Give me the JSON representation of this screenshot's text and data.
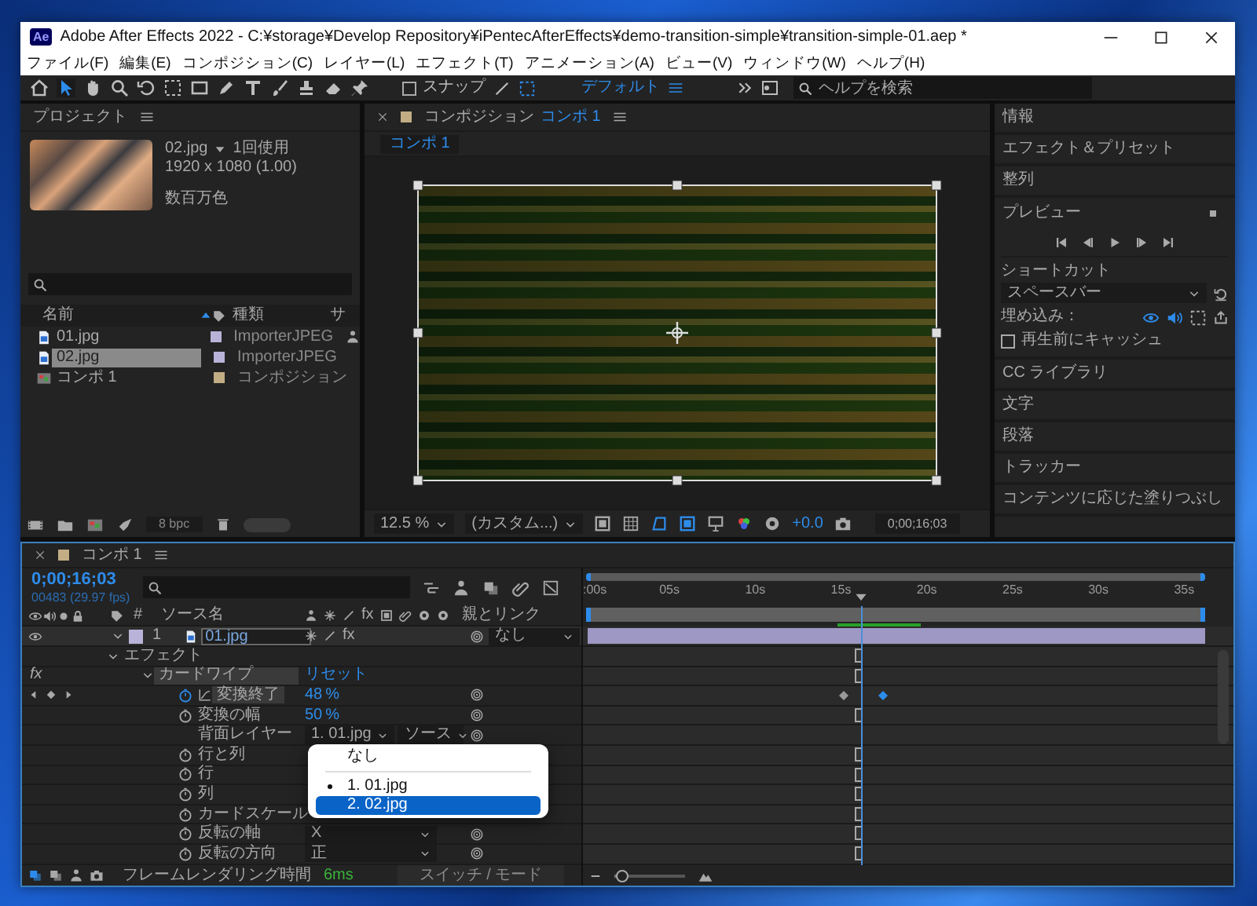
{
  "window": {
    "app_badge": "Ae",
    "title": "Adobe After Effects 2022 - C:¥storage¥Develop Repository¥iPentecAfterEffects¥demo-transition-simple¥transition-simple-01.aep *"
  },
  "menu": [
    "ファイル(F)",
    "編集(E)",
    "コンポジション(C)",
    "レイヤー(L)",
    "エフェクト(T)",
    "アニメーション(A)",
    "ビュー(V)",
    "ウィンドウ(W)",
    "ヘルプ(H)"
  ],
  "toolbar": {
    "snap_label": "スナップ",
    "snap_checked": false,
    "workspace": "デフォルト",
    "search_placeholder": "ヘルプを検索"
  },
  "project": {
    "title": "プロジェクト",
    "preview_name": "02.jpg",
    "usage": "1回使用",
    "dimensions": "1920 x 1080 (1.00)",
    "colors": "数百万色",
    "columns": [
      "名前",
      "種類",
      "サ"
    ],
    "items": [
      {
        "name": "01.jpg",
        "type": "ImporterJPEG",
        "kind": "image",
        "color": "#b9b3d9",
        "selected": false
      },
      {
        "name": "02.jpg",
        "type": "ImporterJPEG",
        "kind": "image",
        "color": "#b9b3d9",
        "selected": true
      },
      {
        "name": "コンポ 1",
        "type": "コンポジション",
        "kind": "comp",
        "color": "#c2ad84",
        "selected": false
      }
    ],
    "bpc": "8 bpc"
  },
  "viewer": {
    "title": "コンポジション",
    "comp_name": "コンポ 1",
    "tab": "コンポ 1",
    "zoom": "12.5 %",
    "resolution": "(カスタム...)",
    "exposure": "+0.0",
    "timecode": "0;00;16;03"
  },
  "right_panel": {
    "items_top": [
      "情報",
      "エフェクト＆プリセット",
      "整列"
    ],
    "preview": {
      "title": "プレビュー",
      "shortcut_label": "ショートカット",
      "shortcut": "スペースバー",
      "embed_label": "埋め込み：",
      "cache_label": "再生前にキャッシュ",
      "cache_checked": false
    },
    "items_bottom": [
      "CC ライブラリ",
      "文字",
      "段落",
      "トラッカー",
      "コンテンツに応じた塗りつぶし"
    ]
  },
  "timeline": {
    "tab": "コンポ 1",
    "timecode": "0;00;16;03",
    "frames": "00483 (29.97 fps)",
    "number_header": "#",
    "source_header": "ソース名",
    "switch_fx": "fx",
    "parent_header": "親とリンク",
    "ticks": [
      ":00s",
      "05s",
      "10s",
      "15s",
      "20s",
      "25s",
      "30s",
      "35s"
    ],
    "layer": {
      "number": "1",
      "name": "01.jpg",
      "color": "#b9b3d9",
      "switch_fx": "fx",
      "fx_enabled": true,
      "parent": "なし"
    },
    "rows": [
      {
        "kind": "group",
        "label": "エフェクト",
        "marker": true
      },
      {
        "kind": "effect",
        "fx": "fx",
        "label": "カードワイプ",
        "reset": "リセット",
        "marker": true
      },
      {
        "kind": "property",
        "label": "変換終了",
        "value": "48",
        "unit": "%",
        "animated": true,
        "selected": true,
        "marker": false
      },
      {
        "kind": "property",
        "label": "変換の幅",
        "value": "50",
        "unit": "%",
        "animated": false,
        "selected": false,
        "marker": true
      },
      {
        "kind": "layer_select",
        "label": "背面レイヤー",
        "value": "1. 01.jpg",
        "source": "ソース",
        "marker": false
      },
      {
        "kind": "property",
        "label": "行と列",
        "animated": false,
        "selected": false,
        "marker": true
      },
      {
        "kind": "property",
        "label": "行",
        "animated": false,
        "selected": false,
        "marker": true
      },
      {
        "kind": "property",
        "label": "列",
        "animated": false,
        "selected": false,
        "marker": true
      },
      {
        "kind": "property",
        "label": "カードスケール",
        "animated": false,
        "selected": false,
        "marker": true
      },
      {
        "kind": "choice",
        "label": "反転の軸",
        "value": "X",
        "marker": true
      },
      {
        "kind": "choice",
        "label": "反転の方向",
        "value": "正",
        "marker": true
      }
    ],
    "render_label": "フレームレンダリング時間",
    "render_time": "6ms",
    "toggle": "スイッチ / モード",
    "zoom_slider": {
      "level": 0.1
    }
  },
  "dropdown": {
    "options": [
      {
        "label": "なし",
        "current": false,
        "selected": false,
        "separator_after": true
      },
      {
        "label": "1. 01.jpg",
        "current": true,
        "selected": false,
        "separator_after": false
      },
      {
        "label": "2. 02.jpg",
        "current": false,
        "selected": true,
        "separator_after": false
      }
    ]
  }
}
